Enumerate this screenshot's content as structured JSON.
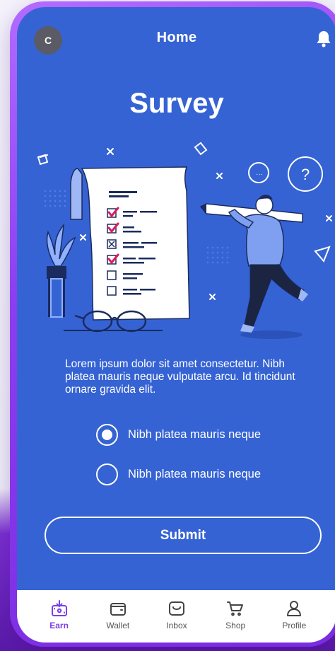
{
  "topbar": {
    "avatar_initial": "C",
    "title": "Home"
  },
  "survey": {
    "title": "Survey",
    "description": "Lorem ipsum dolor sit amet consectetur. Nibh platea mauris neque vulputate arcu. Id tincidunt ornare gravida elit.",
    "options": [
      {
        "label": "Nibh platea mauris neque",
        "selected": true
      },
      {
        "label": "Nibh platea mauris neque",
        "selected": false
      }
    ],
    "submit_label": "Submit"
  },
  "nav": {
    "items": [
      {
        "label": "Earn",
        "icon": "earn-icon",
        "active": true
      },
      {
        "label": "Wallet",
        "icon": "wallet-icon",
        "active": false
      },
      {
        "label": "Inbox",
        "icon": "inbox-icon",
        "active": false
      },
      {
        "label": "Shop",
        "icon": "cart-icon",
        "active": false
      },
      {
        "label": "Profile",
        "icon": "user-icon",
        "active": false
      }
    ]
  },
  "colors": {
    "screen_bg": "#3563d4",
    "accent": "#7b3fe4",
    "frame": "#8b3df0",
    "checkmark": "#d81b60"
  }
}
